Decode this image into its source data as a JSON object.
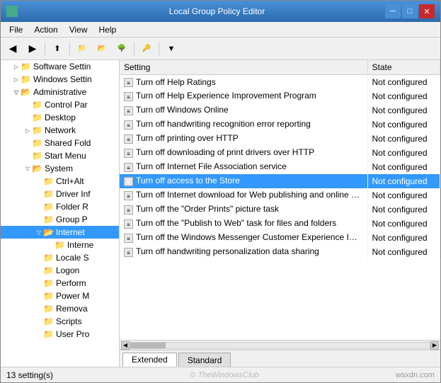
{
  "window": {
    "title": "Local Group Policy Editor",
    "controls": {
      "minimize": "─",
      "maximize": "□",
      "close": "✕"
    }
  },
  "menu": {
    "items": [
      "File",
      "Action",
      "View",
      "Help"
    ]
  },
  "toolbar": {
    "buttons": [
      "◀",
      "▶",
      "⬆",
      "📋",
      "📋",
      "◀",
      "📋",
      "📋",
      "🔑",
      "📋",
      "▼"
    ]
  },
  "tree": {
    "items": [
      {
        "label": "Software Settin",
        "indent": 1,
        "expanded": false,
        "hasArrow": false
      },
      {
        "label": "Windows Settin",
        "indent": 1,
        "expanded": false,
        "hasArrow": false
      },
      {
        "label": "Administrative",
        "indent": 1,
        "expanded": true,
        "hasArrow": true
      },
      {
        "label": "Control Par",
        "indent": 2,
        "expanded": false,
        "hasArrow": false
      },
      {
        "label": "Desktop",
        "indent": 2,
        "expanded": false,
        "hasArrow": false
      },
      {
        "label": "Network",
        "indent": 2,
        "expanded": false,
        "hasArrow": false
      },
      {
        "label": "Shared Fold",
        "indent": 2,
        "expanded": false,
        "hasArrow": false
      },
      {
        "label": "Start Menu",
        "indent": 2,
        "expanded": false,
        "hasArrow": false
      },
      {
        "label": "System",
        "indent": 2,
        "expanded": true,
        "hasArrow": true
      },
      {
        "label": "Ctrl+Alt",
        "indent": 3,
        "expanded": false,
        "hasArrow": false
      },
      {
        "label": "Driver Inf",
        "indent": 3,
        "expanded": false,
        "hasArrow": false
      },
      {
        "label": "Folder R",
        "indent": 3,
        "expanded": false,
        "hasArrow": false
      },
      {
        "label": "Group P",
        "indent": 3,
        "expanded": false,
        "hasArrow": false
      },
      {
        "label": "Internet",
        "indent": 3,
        "expanded": true,
        "hasArrow": true,
        "selected": false
      },
      {
        "label": "Interne",
        "indent": 4,
        "expanded": false,
        "hasArrow": false
      },
      {
        "label": "Locale S",
        "indent": 3,
        "expanded": false,
        "hasArrow": false
      },
      {
        "label": "Logon",
        "indent": 3,
        "expanded": false,
        "hasArrow": false
      },
      {
        "label": "Perform",
        "indent": 3,
        "expanded": false,
        "hasArrow": false
      },
      {
        "label": "Power M",
        "indent": 3,
        "expanded": false,
        "hasArrow": false
      },
      {
        "label": "Remova",
        "indent": 3,
        "expanded": false,
        "hasArrow": false
      },
      {
        "label": "Scripts",
        "indent": 3,
        "expanded": false,
        "hasArrow": false
      },
      {
        "label": "User Pro",
        "indent": 3,
        "expanded": false,
        "hasArrow": false
      }
    ]
  },
  "table": {
    "columns": [
      {
        "label": "Setting",
        "width": "70%"
      },
      {
        "label": "State",
        "width": "30%"
      }
    ],
    "rows": [
      {
        "setting": "Turn off Help Ratings",
        "state": "Not configured",
        "selected": false
      },
      {
        "setting": "Turn off Help Experience Improvement Program",
        "state": "Not configured",
        "selected": false
      },
      {
        "setting": "Turn off Windows Online",
        "state": "Not configured",
        "selected": false
      },
      {
        "setting": "Turn off handwriting recognition error reporting",
        "state": "Not configured",
        "selected": false
      },
      {
        "setting": "Turn off printing over HTTP",
        "state": "Not configured",
        "selected": false
      },
      {
        "setting": "Turn off downloading of print drivers over HTTP",
        "state": "Not configured",
        "selected": false
      },
      {
        "setting": "Turn off Internet File Association service",
        "state": "Not configured",
        "selected": false
      },
      {
        "setting": "Turn off access to the Store",
        "state": "Not configured",
        "selected": true
      },
      {
        "setting": "Turn off Internet download for Web publishing and online o...",
        "state": "Not configured",
        "selected": false
      },
      {
        "setting": "Turn off the \"Order Prints\" picture task",
        "state": "Not configured",
        "selected": false
      },
      {
        "setting": "Turn off the \"Publish to Web\" task for files and folders",
        "state": "Not configured",
        "selected": false
      },
      {
        "setting": "Turn off the Windows Messenger Customer Experience Impr...",
        "state": "Not configured",
        "selected": false
      },
      {
        "setting": "Turn off handwriting personalization data sharing",
        "state": "Not configured",
        "selected": false
      }
    ]
  },
  "tabs": [
    {
      "label": "Extended",
      "active": true
    },
    {
      "label": "Standard",
      "active": false
    }
  ],
  "statusbar": {
    "count": "13 setting(s)",
    "watermark": "© TheWindowsClub",
    "site": "wsxdn.com"
  }
}
